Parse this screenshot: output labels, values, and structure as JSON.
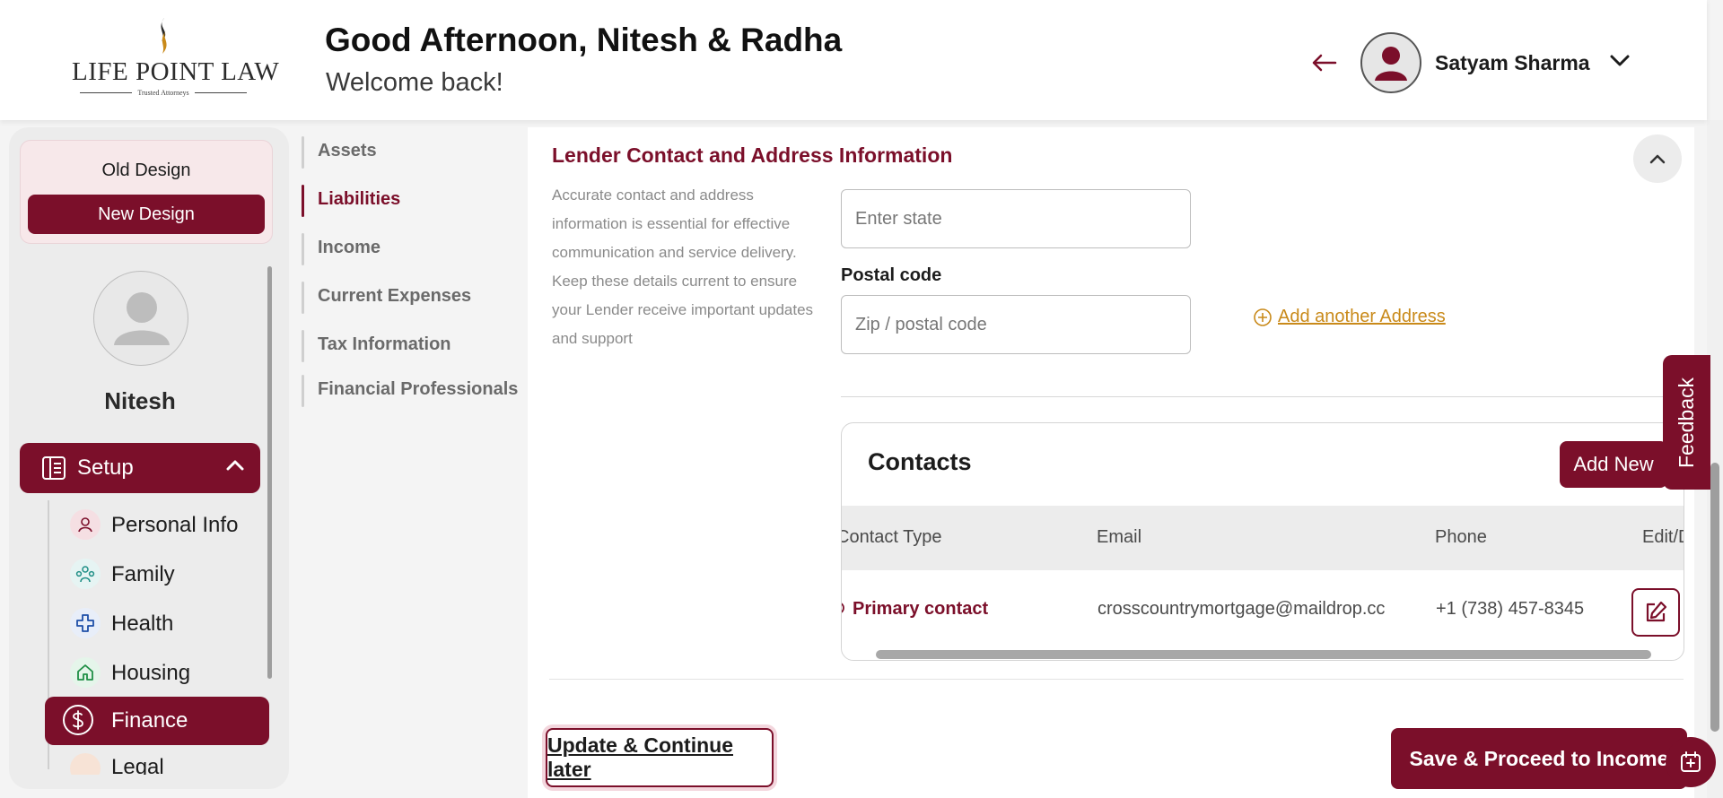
{
  "header": {
    "logo": {
      "name": "LIFE POINT LAW",
      "tagline": "Trusted Attorneys"
    },
    "greeting": "Good Afternoon, Nitesh & Radha",
    "welcome": "Welcome back!",
    "user_name": "Satyam Sharma"
  },
  "sidebar": {
    "design_toggle": {
      "old": "Old Design",
      "new": "New Design"
    },
    "profile_name": "Nitesh",
    "setup_label": "Setup",
    "items": [
      {
        "label": "Personal Info",
        "icon": "person-icon"
      },
      {
        "label": "Family",
        "icon": "family-icon"
      },
      {
        "label": "Health",
        "icon": "health-cross-icon"
      },
      {
        "label": "Housing",
        "icon": "house-icon"
      },
      {
        "label": "Finance",
        "icon": "dollar-icon",
        "active": true
      },
      {
        "label": "Legal",
        "icon": "legal-icon"
      }
    ]
  },
  "section_nav": {
    "items": [
      {
        "label": "Assets"
      },
      {
        "label": "Liabilities",
        "active": true
      },
      {
        "label": "Income"
      },
      {
        "label": "Current Expenses"
      },
      {
        "label": "Tax Information"
      },
      {
        "label": "Financial Professionals"
      }
    ]
  },
  "main": {
    "section_title": "Lender Contact and Address Information",
    "description": "Accurate contact and address information is essential for effective communication and service delivery. Keep these details current to ensure your Lender receive important updates and support",
    "state_placeholder": "Enter state",
    "postal_label": "Postal code",
    "postal_placeholder": "Zip / postal code",
    "add_address": "Add another Address",
    "contacts": {
      "title": "Contacts",
      "add_new": "Add New",
      "columns": [
        "Contact Type",
        "Email",
        "Phone",
        "Edit/Delete"
      ],
      "rows": [
        {
          "type": "Primary contact",
          "email": "crosscountrymortgage@maildrop.cc",
          "phone": "+1 (738) 457-8345"
        }
      ]
    },
    "update_button": "Update & Continue later",
    "save_button": "Save & Proceed to Income"
  },
  "feedback": "Feedback",
  "colors": {
    "brand": "#7b0f2a",
    "link": "#c98a1a"
  }
}
